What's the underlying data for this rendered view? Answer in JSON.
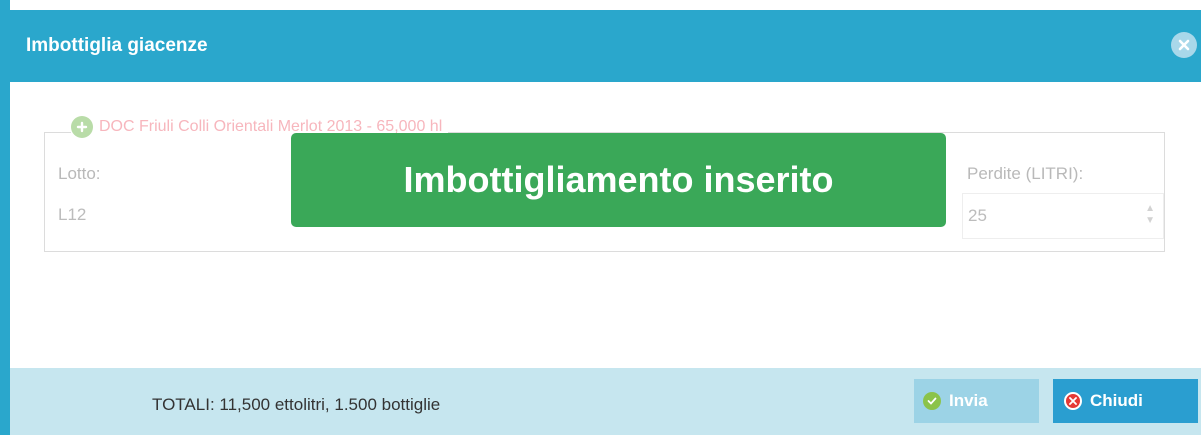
{
  "dialog": {
    "title": "Imbottiglia giacenze",
    "close_icon": "close-circle-icon"
  },
  "section": {
    "legend_icon": "plus-circle-icon",
    "legend": "DOC Friuli Colli Orientali Merlot 2013 - 65,000 hl",
    "lotto_label": "Lotto:",
    "lotto_value": "L12",
    "perdite_label": "Perdite (LITRI):",
    "perdite_value": "25"
  },
  "notification": {
    "message": "Imbottigliamento inserito",
    "color": "#3aa858"
  },
  "footer": {
    "totals": "TOTALI: 11,500 ettolitri, 1.500 bottiglie",
    "invia_label": "Invia",
    "invia_icon": "check-circle-icon",
    "chiudi_label": "Chiudi",
    "chiudi_icon": "x-circle-icon"
  },
  "colors": {
    "header": "#2aa7cc",
    "footer": "#c6e6ef",
    "chiudi": "#2a9ed0",
    "invia": "#9cd3e6"
  }
}
